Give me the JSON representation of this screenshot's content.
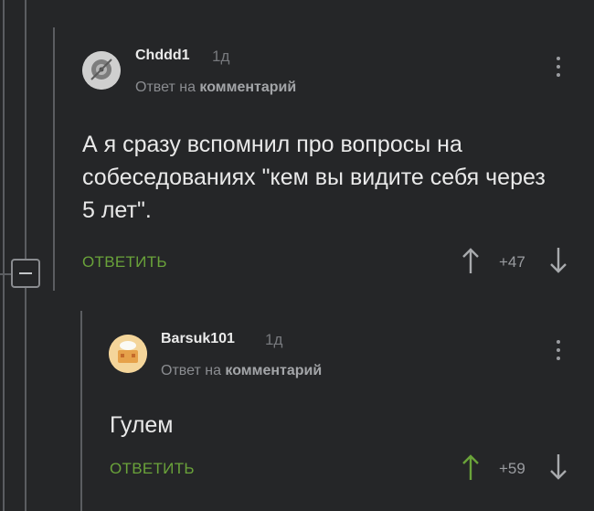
{
  "comments": [
    {
      "username": "Chddd1",
      "age": "1д",
      "reply_prefix": "Ответ на",
      "reply_target": "комментарий",
      "text": "А я сразу вспомнил про вопросы на собеседованиях \"кем вы видите себя через 5 лет\".",
      "reply_label": "ОТВЕТИТЬ",
      "score": "+47",
      "upvoted": false
    },
    {
      "username": "Barsuk101",
      "age": "1д",
      "reply_prefix": "Ответ на",
      "reply_target": "комментарий",
      "text": "Гулем",
      "reply_label": "ОТВЕТИТЬ",
      "score": "+59",
      "upvoted": true
    }
  ],
  "colors": {
    "background": "#252628",
    "accent_green": "#6aa33a",
    "text": "#e9e9e9",
    "muted": "#8b8d91",
    "thread_line": "#5b5d61"
  },
  "icons": [
    "collapse-thread-icon",
    "more-vertical-icon",
    "upvote-arrow-icon",
    "downvote-arrow-icon"
  ]
}
